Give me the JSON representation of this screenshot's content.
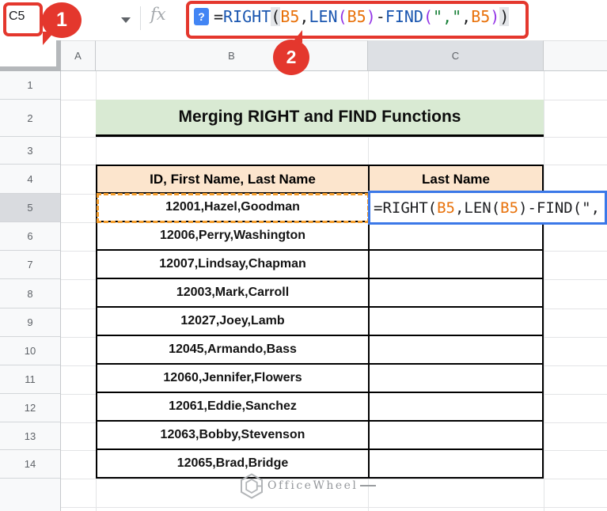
{
  "name_box": {
    "value": "C5"
  },
  "annotations": {
    "step1": "1",
    "step2": "2"
  },
  "formula_bar": {
    "fx_label": "fx",
    "help_icon": "?",
    "formula_full": "=RIGHT(B5,LEN(B5)-FIND(\",\",B5))",
    "tokens": [
      {
        "t": "=",
        "c": "#202124"
      },
      {
        "t": "RIGHT",
        "c": "#1a56b0"
      },
      {
        "t": "(",
        "c": "#202124"
      },
      {
        "t": "B5",
        "c": "#e8710a"
      },
      {
        "t": ",",
        "c": "#202124"
      },
      {
        "t": "LEN",
        "c": "#1a56b0"
      },
      {
        "t": "(",
        "c": "#9334e6"
      },
      {
        "t": "B5",
        "c": "#e8710a"
      },
      {
        "t": ")",
        "c": "#9334e6"
      },
      {
        "t": "-",
        "c": "#202124"
      },
      {
        "t": "FIND",
        "c": "#1a56b0"
      },
      {
        "t": "(",
        "c": "#9334e6"
      },
      {
        "t": "\",\"",
        "c": "#188038"
      },
      {
        "t": ",",
        "c": "#202124"
      },
      {
        "t": "B5",
        "c": "#e8710a"
      },
      {
        "t": ")",
        "c": "#9334e6"
      },
      {
        "t": ")",
        "c": "#202124"
      }
    ]
  },
  "column_headers": {
    "a": "A",
    "b": "B",
    "c": "C"
  },
  "row_numbers": [
    "1",
    "2",
    "3",
    "4",
    "5",
    "6",
    "7",
    "8",
    "9",
    "10",
    "11",
    "12",
    "13",
    "14"
  ],
  "title": {
    "text": "Merging RIGHT and FIND Functions",
    "bg": "#d9ead3"
  },
  "table": {
    "col1_header": "ID, First Name, Last Name",
    "col2_header": "Last Name",
    "rows": [
      "12001,Hazel,Goodman",
      "12006,Perry,Washington",
      "12007,Lindsay,Chapman",
      "12003,Mark,Carroll",
      "12027,Joey,Lamb",
      "12045,Armando,Bass",
      "12060,Jennifer,Flowers",
      "12061,Eddie,Sanchez",
      "12063,Bobby,Stevenson",
      "12065,Brad,Bridge"
    ]
  },
  "cell_editor": {
    "visible_text": "=RIGHT(B5,LEN(B5)-FIND(\",",
    "tokens": [
      {
        "t": "=RIGHT(",
        "c": "#202124"
      },
      {
        "t": "B5",
        "c": "#e8710a"
      },
      {
        "t": ",LEN(",
        "c": "#202124"
      },
      {
        "t": "B5",
        "c": "#e8710a"
      },
      {
        "t": ")-FIND(\",",
        "c": "#202124"
      }
    ]
  },
  "watermark": {
    "text": "OfficeWheel"
  },
  "colors": {
    "annotation_red": "#e4372d",
    "title_bg": "#d9ead3",
    "table_header_bg": "#fce5cd",
    "active_cell_border": "#3b78e8",
    "referenced_cell_border": "#f59e2d",
    "selected_header_bg": "#dde0e4",
    "function_blue": "#1a56b0",
    "reference_orange": "#e8710a",
    "string_green": "#188038",
    "paren_purple": "#9334e6"
  }
}
